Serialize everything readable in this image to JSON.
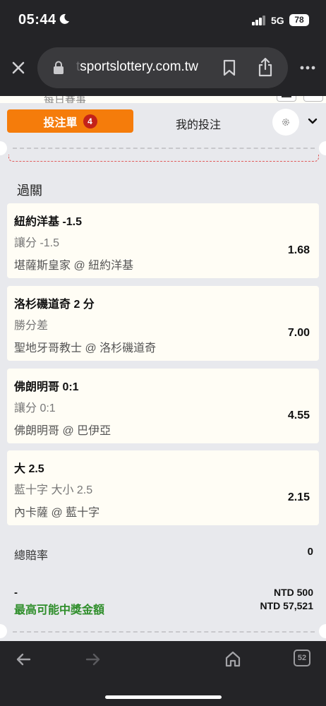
{
  "status_bar": {
    "time": "05:44",
    "network": "5G",
    "battery": "78"
  },
  "browser": {
    "url_prefix": "t",
    "url_domain": "sportslottery.com.tw",
    "tab_count": "52"
  },
  "page": {
    "clipped_header_text": "每日賽事",
    "tabs": {
      "betslip_label": "投注單",
      "betslip_count": "4",
      "mybets_label": "我的投注"
    },
    "section_title": "過關",
    "bets": [
      {
        "title": "紐約洋基 -1.5",
        "market": "讓分 -1.5",
        "game": "堪薩斯皇家 @ 紐約洋基",
        "odds": "1.68"
      },
      {
        "title": "洛杉磯道奇 2 分",
        "market": "勝分差",
        "game": "聖地牙哥教士 @ 洛杉磯道奇",
        "odds": "7.00"
      },
      {
        "title": "佛朗明哥 0:1",
        "market": "讓分 0:1",
        "game": "佛朗明哥 @ 巴伊亞",
        "odds": "4.55"
      },
      {
        "title": "大 2.5",
        "market": "藍十字 大小 2.5",
        "game": "內卡薩 @ 藍十字",
        "odds": "2.15"
      }
    ],
    "total_odds_label": "總賠率",
    "total_odds_value": "0",
    "dash_symbol": "-",
    "max_win_label": "最高可能中獎金額",
    "stake_value": "NTD 500",
    "max_win_value": "NTD 57,521"
  },
  "colors": {
    "accent": "#f57c0b",
    "badge": "#c3221a",
    "win_green": "#2f8e2b"
  }
}
